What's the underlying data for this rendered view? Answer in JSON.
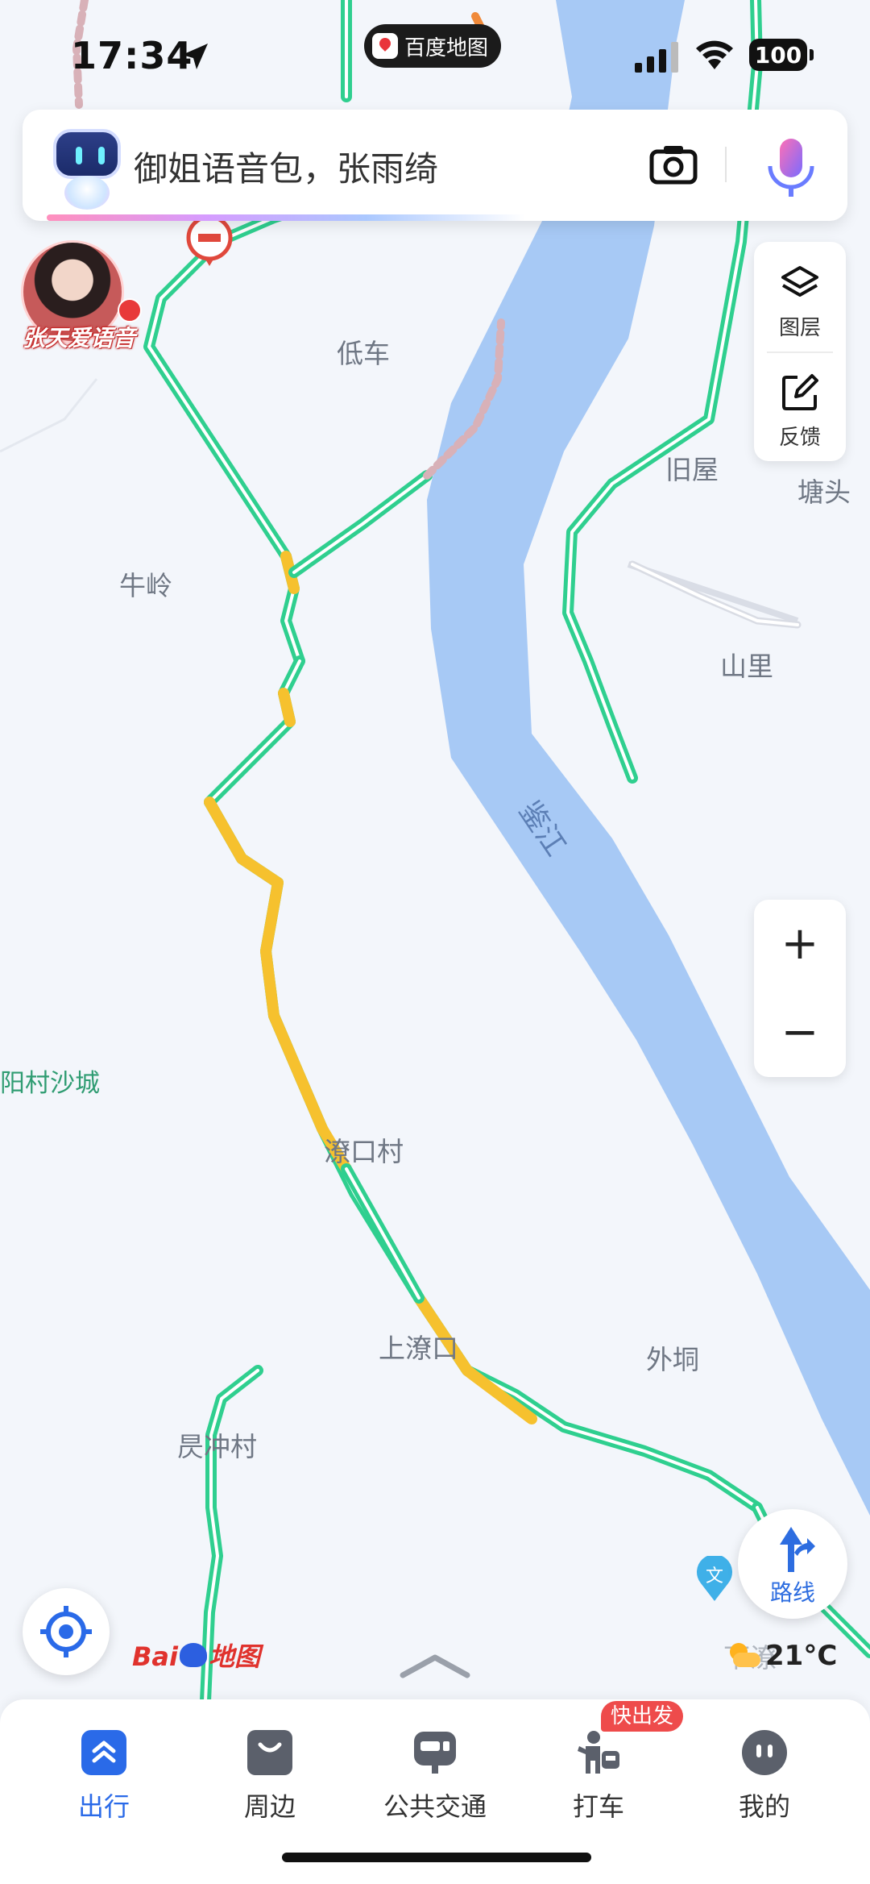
{
  "status_bar": {
    "time": "17:34",
    "app_name": "百度地图",
    "battery": "100"
  },
  "search": {
    "placeholder_text": "御姐语音包，张雨绮"
  },
  "voice_pack": {
    "label": "张天爱语音"
  },
  "map_controls": {
    "layers_label": "图层",
    "feedback_label": "反馈",
    "zoom_in": "+",
    "zoom_out": "−"
  },
  "map_labels": {
    "dichhe": "低车",
    "jiuwu": "旧屋",
    "tangtou": "塘头",
    "niuling": "牛岭",
    "shanli": "山里",
    "river": "鉴江",
    "shacheng": "阳村沙城",
    "liaokou": "潦口村",
    "shangliaokou": "上潦口",
    "waitong": "外垌",
    "zechong": "昃冲村",
    "xiacao": "下潦"
  },
  "brand": {
    "logo_text_left": "Bai",
    "logo_text_right": "地图"
  },
  "route_button": {
    "label": "路线"
  },
  "weather": {
    "temp": "21°C"
  },
  "tabs": [
    {
      "label": "出行",
      "active": true
    },
    {
      "label": "周边",
      "active": false
    },
    {
      "label": "公共交通",
      "active": false
    },
    {
      "label": "打车",
      "active": false,
      "badge": "快出发"
    },
    {
      "label": "我的",
      "active": false
    }
  ],
  "colors": {
    "accent": "#2a6ae8",
    "river": "#a7c9f5",
    "road_green": "#2fcf8f",
    "road_yellow": "#f6c12e",
    "badge_red": "#ee4b4b"
  }
}
